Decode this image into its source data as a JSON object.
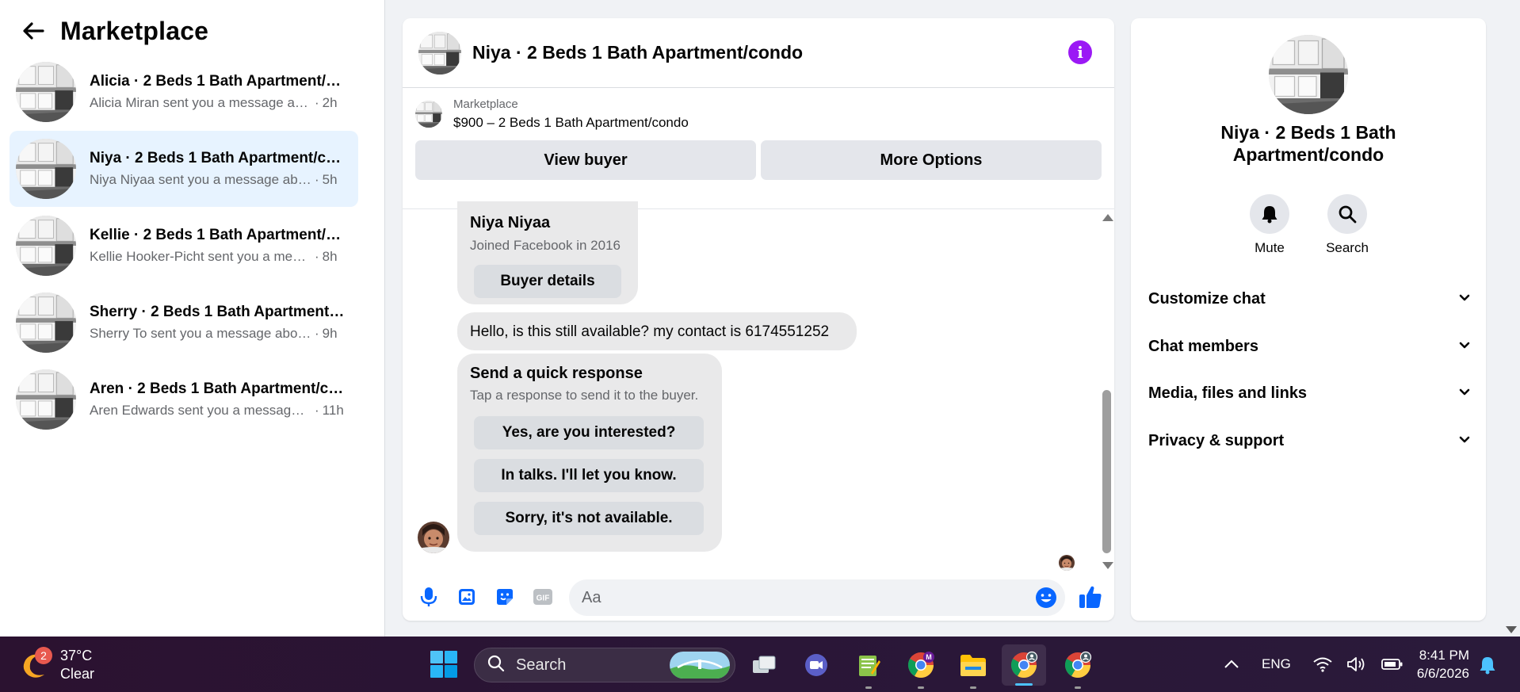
{
  "sidebar": {
    "title": "Marketplace",
    "conversations": [
      {
        "name": "Alicia · 2 Beds 1 Bath Apartment/condo",
        "preview": "Alicia Miran sent you a message about your listing",
        "time": "2h"
      },
      {
        "name": "Niya · 2 Beds 1 Bath Apartment/condo",
        "preview": "Niya Niyaa sent you a message about your listing",
        "time": "5h"
      },
      {
        "name": "Kellie · 2 Beds 1 Bath Apartment/condo",
        "preview": "Kellie Hooker-Picht sent you a message about your listing",
        "time": "8h"
      },
      {
        "name": "Sherry · 2 Beds 1 Bath Apartment/condo",
        "preview": "Sherry To sent you a message about your listing",
        "time": "9h"
      },
      {
        "name": "Aren · 2 Beds 1 Bath Apartment/condo",
        "preview": "Aren Edwards sent you a message about your listing",
        "time": "11h"
      }
    ]
  },
  "chat": {
    "title": "Niya · 2 Beds 1 Bath Apartment/condo",
    "listing_source": "Marketplace",
    "listing_price": "$900 – 2 Beds 1 Bath Apartment/condo",
    "view_buyer": "View buyer",
    "more_options": "More Options",
    "buyer_name": "Niya Niyaa",
    "buyer_joined": "Joined Facebook in 2016",
    "buyer_details": "Buyer details",
    "message": "Hello, is this still available? my contact is 6174551252",
    "quick_title": "Send a quick response",
    "quick_sub": "Tap a response to send it to the buyer.",
    "quick_responses": [
      "Yes, are you interested?",
      "In talks. I'll let you know.",
      "Sorry, it's not available."
    ],
    "input_placeholder": "Aa"
  },
  "details": {
    "title": "Niya · 2 Beds 1 Bath Apartment/condo",
    "mute": "Mute",
    "search": "Search",
    "sections": [
      "Customize chat",
      "Chat members",
      "Media, files and links",
      "Privacy & support"
    ]
  },
  "taskbar": {
    "badge": "2",
    "temperature": "37°C",
    "condition": "Clear",
    "search_label": "Search",
    "language": "ENG",
    "time": "8:41 PM",
    "date": "6/6/2026",
    "chrome_badge": "M"
  },
  "colors": {
    "accent": "#0866ff",
    "info": "#9b19f5",
    "active_row": "#e7f3ff"
  }
}
